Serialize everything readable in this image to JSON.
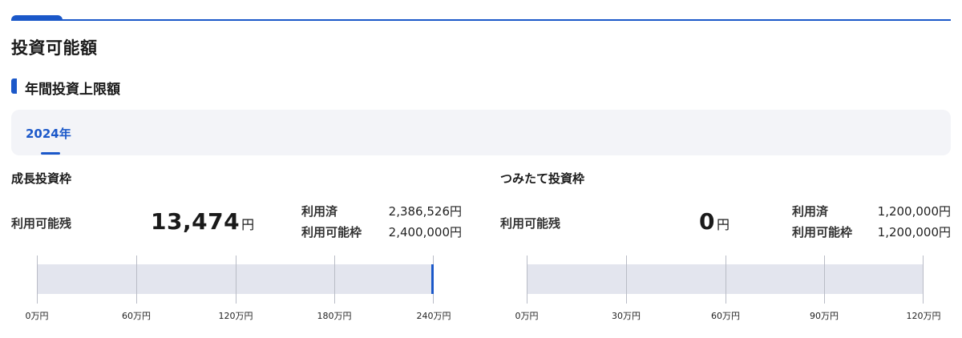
{
  "page": {
    "title": "投資可能額"
  },
  "subsection": {
    "title": "年間投資上限額"
  },
  "year_tabs": [
    {
      "label": "2024年",
      "selected": true
    }
  ],
  "colors": {
    "accent": "#1b58c9",
    "track": "#e3e5ee",
    "panel": "#f3f4f8"
  },
  "growth": {
    "title": "成長投資枠",
    "available_label": "利用可能残",
    "available_value": "13,474",
    "available_unit": "円",
    "used_label": "利用済",
    "used_value": "2,386,526円",
    "limit_label": "利用可能枠",
    "limit_value": "2,400,000円",
    "bar": {
      "max_man": 240,
      "used_man": 238.6526,
      "ticks": [
        "0万円",
        "60万円",
        "120万円",
        "180万円",
        "240万円"
      ]
    }
  },
  "tsumitate": {
    "title": "つみたて投資枠",
    "available_label": "利用可能残",
    "available_value": "0",
    "available_unit": "円",
    "used_label": "利用済",
    "used_value": "1,200,000円",
    "limit_label": "利用可能枠",
    "limit_value": "1,200,000円",
    "bar": {
      "max_man": 120,
      "used_man": 120,
      "ticks": [
        "0万円",
        "30万円",
        "60万円",
        "90万円",
        "120万円"
      ]
    }
  }
}
